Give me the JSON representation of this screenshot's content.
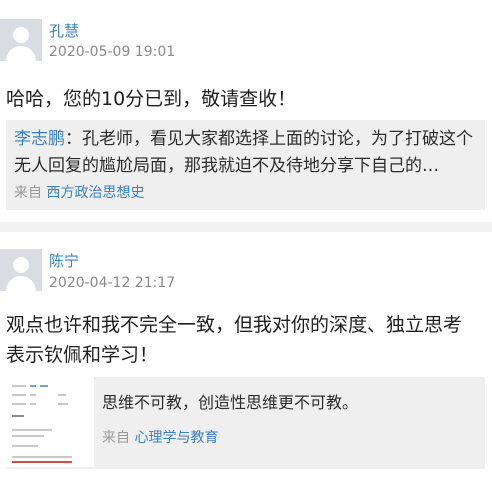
{
  "posts": [
    {
      "author": "孔慧",
      "date": "2020-05-09 19:01",
      "content": "哈哈，您的10分已到，敬请查收！",
      "quote": {
        "user": "李志鹏",
        "text": "：孔老师，看见大家都选择上面的讨论，为了打破这个无人回复的尴尬局面，那我就迫不及待地分享下自己的…",
        "source_prefix": "来自",
        "source": "西方政治思想史"
      }
    },
    {
      "author": "陈宁",
      "date": "2020-04-12 21:17",
      "content": "观点也许和我不完全一致，但我对你的深度、独立思考表示钦佩和学习！",
      "quote": {
        "text": "思维不可教，创造性思维更不可教。",
        "source_prefix": "来自",
        "source": "心理学与教育"
      }
    }
  ],
  "colors": {
    "link": "#3b82c4",
    "meta": "#8a8a8a",
    "quote_bg": "#efefef",
    "avatar_bg": "#d9dce3"
  },
  "icons": {
    "avatar": "default-user-avatar-icon"
  }
}
